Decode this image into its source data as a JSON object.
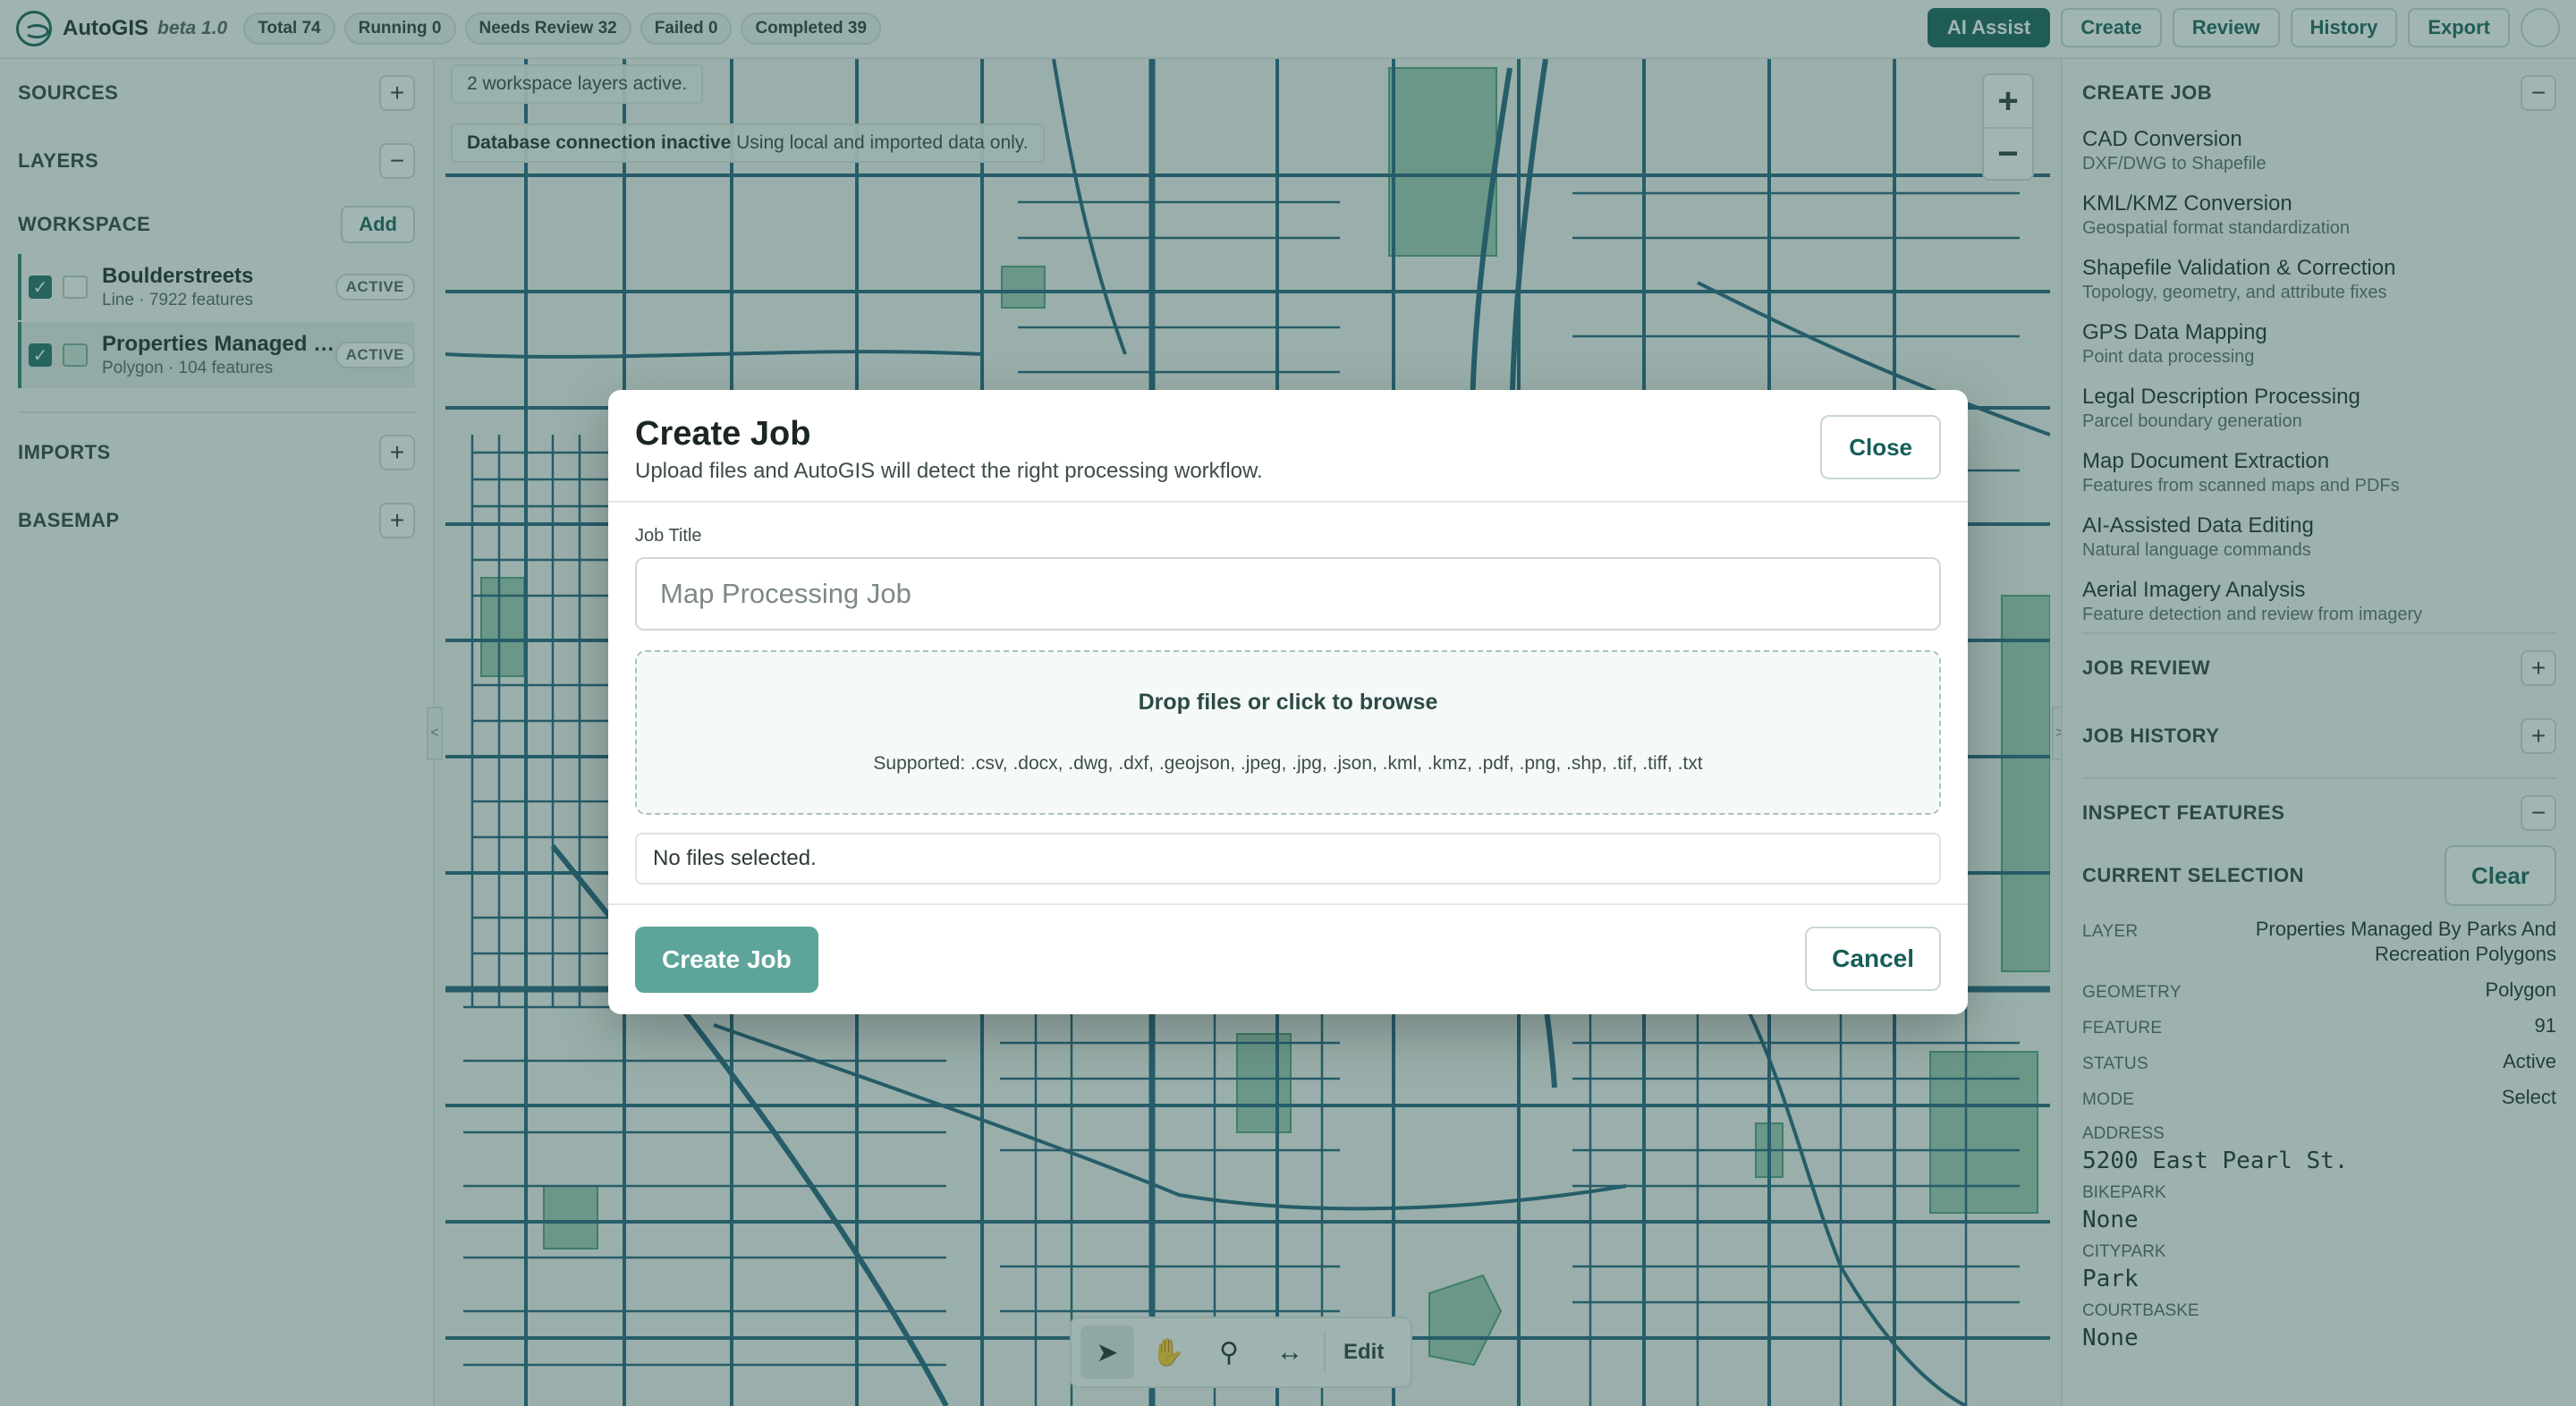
{
  "topbar": {
    "app_name": "AutoGIS",
    "version": "beta 1.0",
    "stats": [
      "Total 74",
      "Running 0",
      "Needs Review 32",
      "Failed 0",
      "Completed 39"
    ],
    "actions": {
      "ai": "AI Assist",
      "create": "Create",
      "review": "Review",
      "history": "History",
      "export": "Export"
    }
  },
  "left": {
    "sources": "SOURCES",
    "layers": "LAYERS",
    "workspace": "WORKSPACE",
    "add": "Add",
    "layer_list": [
      {
        "name": "Boulderstreets",
        "meta": "Line · 7922 features",
        "badge": "ACTIVE"
      },
      {
        "name": "Properties Managed By Parks And Recreation Polygons",
        "meta": "Polygon · 104 features",
        "badge": "ACTIVE"
      }
    ],
    "imports": "IMPORTS",
    "basemap": "BASEMAP",
    "plus": "+",
    "minus": "−"
  },
  "map": {
    "layers_note": "2 workspace layers active.",
    "db_bold": "Database connection inactive",
    "db_rest": "Using local and imported data only.",
    "zoom_in": "+",
    "zoom_out": "−",
    "edit": "Edit",
    "collapse_left": "<",
    "collapse_right": ">"
  },
  "right": {
    "create_job": "CREATE JOB",
    "jobs": [
      {
        "title": "CAD Conversion",
        "desc": "DXF/DWG to Shapefile"
      },
      {
        "title": "KML/KMZ Conversion",
        "desc": "Geospatial format standardization"
      },
      {
        "title": "Shapefile Validation & Correction",
        "desc": "Topology, geometry, and attribute fixes"
      },
      {
        "title": "GPS Data Mapping",
        "desc": "Point data processing"
      },
      {
        "title": "Legal Description Processing",
        "desc": "Parcel boundary generation"
      },
      {
        "title": "Map Document Extraction",
        "desc": "Features from scanned maps and PDFs"
      },
      {
        "title": "AI-Assisted Data Editing",
        "desc": "Natural language commands"
      },
      {
        "title": "Aerial Imagery Analysis",
        "desc": "Feature detection and review from imagery"
      }
    ],
    "job_review": "JOB REVIEW",
    "job_history": "JOB HISTORY",
    "inspect": "INSPECT FEATURES",
    "current_selection": "CURRENT SELECTION",
    "clear": "Clear",
    "props": [
      {
        "k": "LAYER",
        "v": "Properties Managed By Parks And Recreation Polygons"
      },
      {
        "k": "GEOMETRY",
        "v": "Polygon"
      },
      {
        "k": "FEATURE",
        "v": "91"
      },
      {
        "k": "STATUS",
        "v": "Active"
      },
      {
        "k": "MODE",
        "v": "Select"
      }
    ],
    "attrs": [
      {
        "k": "ADDRESS",
        "v": "5200 East Pearl St."
      },
      {
        "k": "BIKEPARK",
        "v": "None"
      },
      {
        "k": "CITYPARK",
        "v": "Park"
      },
      {
        "k": "COURTBASKE",
        "v": "None"
      }
    ]
  },
  "modal": {
    "title": "Create Job",
    "subtitle": "Upload files and AutoGIS will detect the right processing workflow.",
    "close": "Close",
    "job_title_label": "Job Title",
    "job_title_placeholder": "Map Processing Job",
    "drop_main": "Drop files or click to browse",
    "supported": "Supported: .csv, .docx, .dwg, .dxf, .geojson, .jpeg, .jpg, .json, .kml, .kmz, .pdf, .png, .shp, .tif, .tiff, .txt",
    "no_files": "No files selected.",
    "create": "Create Job",
    "cancel": "Cancel"
  },
  "colors": {
    "accent": "#155e58",
    "street": "#1f5f7a",
    "park": "#6fae8c",
    "overlay": "#2e5c54"
  },
  "icons": [
    "logo-icon",
    "plus-icon",
    "minus-icon",
    "check-icon",
    "pointer-icon",
    "hand-icon",
    "search-icon",
    "measure-icon"
  ]
}
